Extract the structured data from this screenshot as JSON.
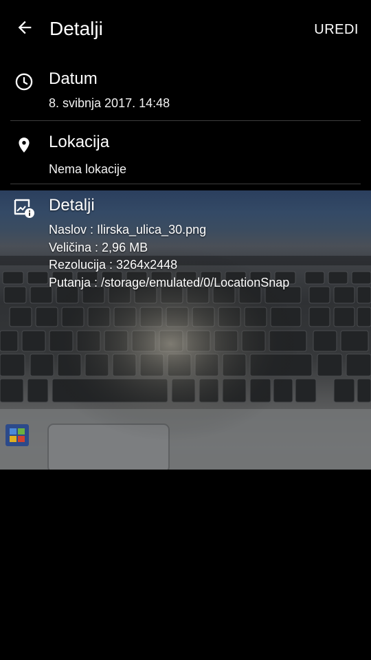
{
  "appbar": {
    "title": "Detalji",
    "edit_label": "UREDI"
  },
  "date_section": {
    "heading": "Datum",
    "value": "8. svibnja 2017. 14:48",
    "icon": "clock-icon"
  },
  "location_section": {
    "heading": "Lokacija",
    "value": "Nema lokacije",
    "icon": "location-pin-icon"
  },
  "details_section": {
    "heading": "Detalji",
    "icon": "image-info-icon",
    "title_line": "Naslov : Ilirska_ulica_30.png",
    "size_line": "Veličina : 2,96 MB",
    "resolution_line": "Rezolucija : 3264x2448",
    "path_line": "Putanja : /storage/emulated/0/LocationSnap"
  },
  "photo": {
    "description_icon": "laptop-keyboard-photo"
  }
}
